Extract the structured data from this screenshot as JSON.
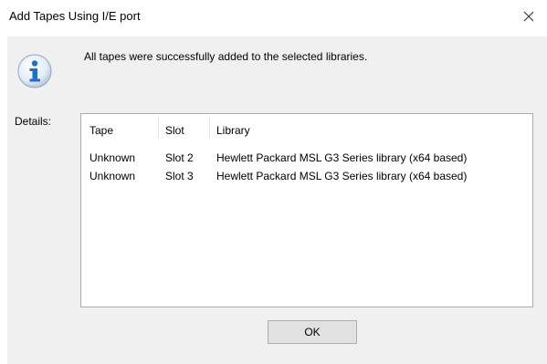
{
  "window": {
    "title": "Add Tapes Using I/E port",
    "close_icon": "close-icon"
  },
  "message": {
    "icon": "info-icon",
    "text": "All tapes were successfully added to the selected libraries."
  },
  "details": {
    "label": "Details:",
    "columns": [
      "Tape",
      "Slot",
      "Library"
    ],
    "rows": [
      {
        "tape": "Unknown",
        "slot": "Slot 2",
        "library": "Hewlett Packard MSL G3 Series library  (x64 based)"
      },
      {
        "tape": "Unknown",
        "slot": "Slot 3",
        "library": "Hewlett Packard MSL G3 Series library  (x64 based)"
      }
    ]
  },
  "buttons": {
    "ok_label": "OK"
  },
  "colors": {
    "dialog_background": "#f0f0f0",
    "info_icon_blue": "#1f6fc5",
    "button_face": "#e1e1e1"
  }
}
